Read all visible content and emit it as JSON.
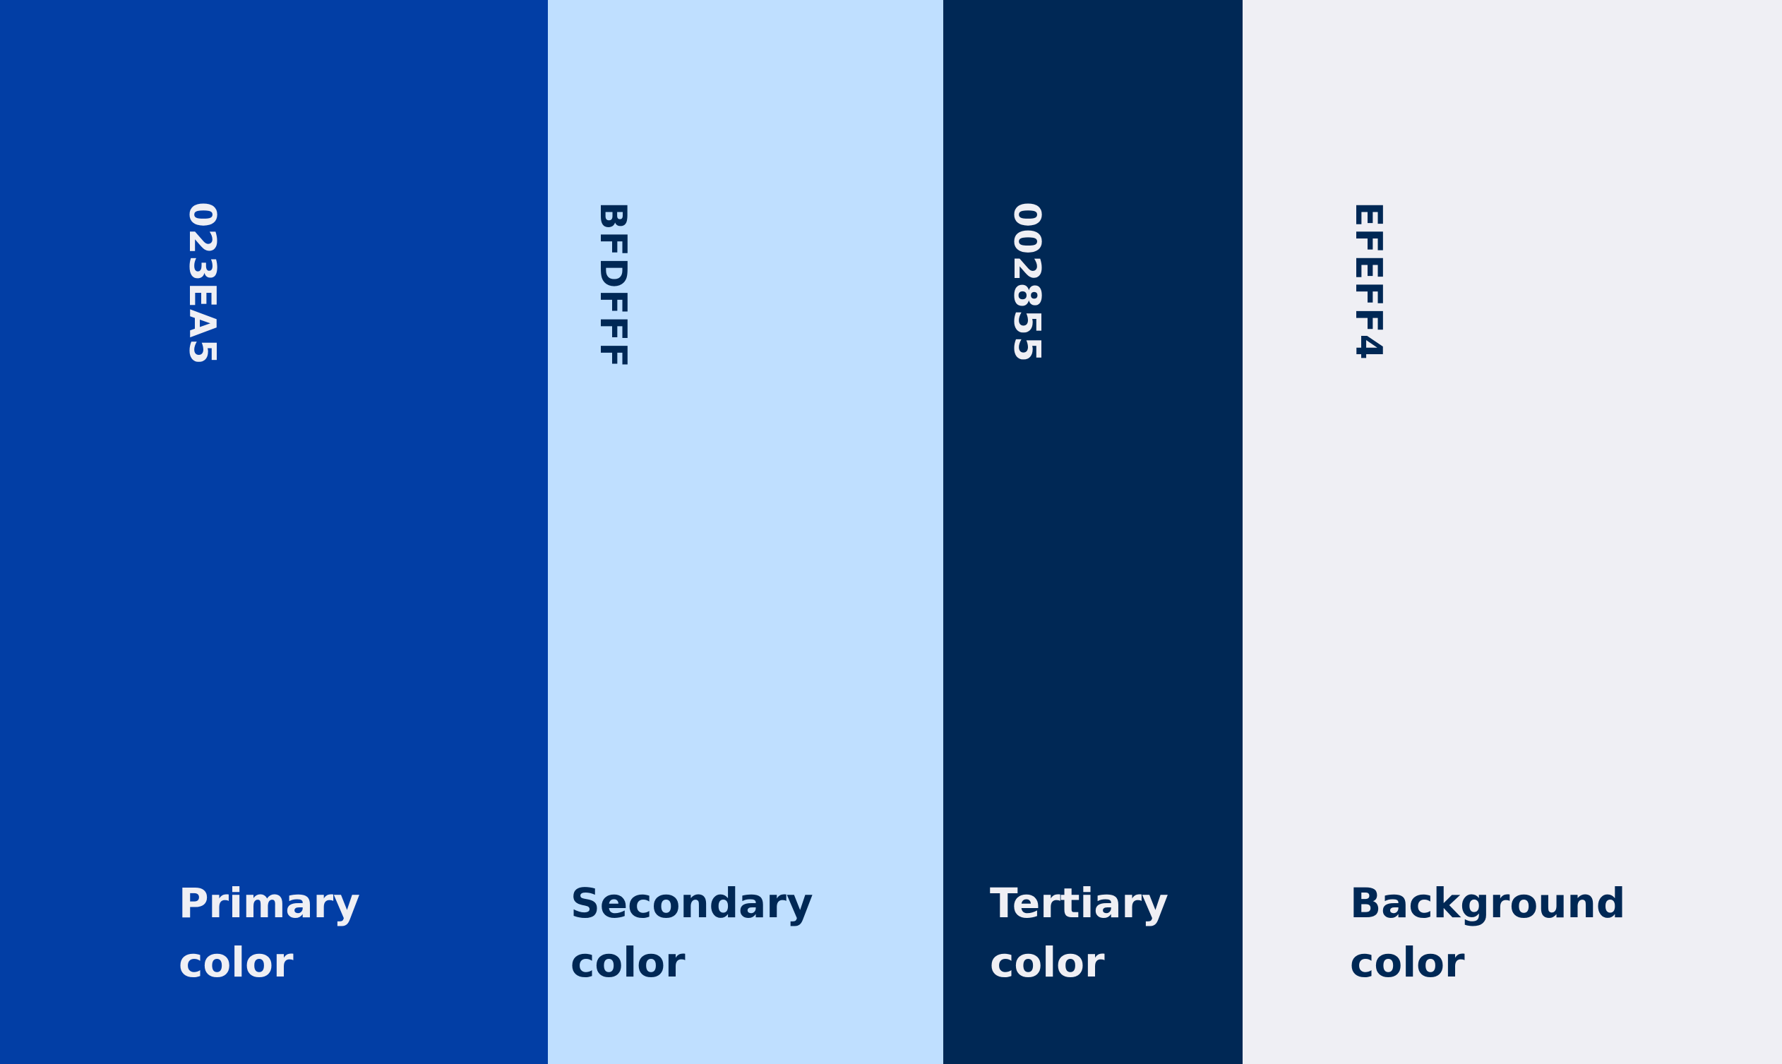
{
  "palette": {
    "swatches": [
      {
        "hex_label": "023EA5",
        "name_line1": "Primary",
        "name_line2": "color",
        "fill": "#023EA5",
        "text_color": "#EFEFF4"
      },
      {
        "hex_label": "BFDFFF",
        "name_line1": "Secondary",
        "name_line2": "color",
        "fill": "#BFDFFF",
        "text_color": "#002855"
      },
      {
        "hex_label": "002855",
        "name_line1": "Tertiary",
        "name_line2": "color",
        "fill": "#002855",
        "text_color": "#EFEFF4"
      },
      {
        "hex_label": "EFEFF4",
        "name_line1": "Background",
        "name_line2": "color",
        "fill": "#EFEFF4",
        "text_color": "#002855"
      }
    ]
  }
}
